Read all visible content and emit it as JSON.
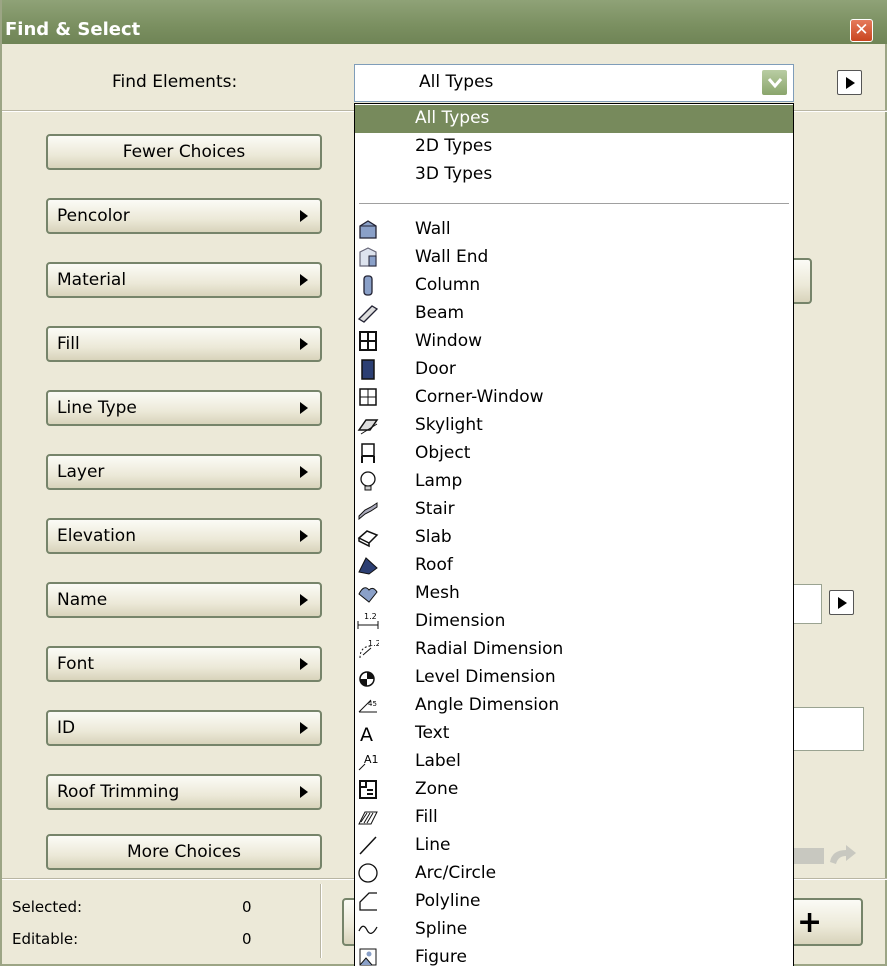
{
  "window": {
    "title": "Find & Select",
    "close_glyph": "✕"
  },
  "find": {
    "label": "Find Elements:",
    "selected": "All Types"
  },
  "buttons": {
    "fewer": "Fewer Choices",
    "more": "More Choices",
    "criteria": [
      "Pencolor",
      "Material",
      "Fill",
      "Line Type",
      "Layer",
      "Elevation",
      "Name",
      "Font",
      "ID",
      "Roof Trimming"
    ]
  },
  "status": {
    "selected_label": "Selected:",
    "selected_value": "0",
    "editable_label": "Editable:",
    "editable_value": "0"
  },
  "plus_glyph": "+",
  "dropdown": {
    "types": [
      "All Types",
      "2D Types",
      "3D Types"
    ],
    "items": [
      {
        "label": "Wall",
        "icon": "wall-icon"
      },
      {
        "label": "Wall End",
        "icon": "wall-end-icon"
      },
      {
        "label": "Column",
        "icon": "column-icon"
      },
      {
        "label": "Beam",
        "icon": "beam-icon"
      },
      {
        "label": "Window",
        "icon": "window-icon"
      },
      {
        "label": "Door",
        "icon": "door-icon"
      },
      {
        "label": "Corner-Window",
        "icon": "corner-window-icon"
      },
      {
        "label": "Skylight",
        "icon": "skylight-icon"
      },
      {
        "label": "Object",
        "icon": "object-icon"
      },
      {
        "label": "Lamp",
        "icon": "lamp-icon"
      },
      {
        "label": "Stair",
        "icon": "stair-icon"
      },
      {
        "label": "Slab",
        "icon": "slab-icon"
      },
      {
        "label": "Roof",
        "icon": "roof-icon"
      },
      {
        "label": "Mesh",
        "icon": "mesh-icon"
      },
      {
        "label": "Dimension",
        "icon": "dimension-icon"
      },
      {
        "label": "Radial Dimension",
        "icon": "radial-dimension-icon"
      },
      {
        "label": "Level Dimension",
        "icon": "level-dimension-icon"
      },
      {
        "label": "Angle Dimension",
        "icon": "angle-dimension-icon"
      },
      {
        "label": "Text",
        "icon": "text-icon"
      },
      {
        "label": "Label",
        "icon": "label-icon"
      },
      {
        "label": "Zone",
        "icon": "zone-icon"
      },
      {
        "label": "Fill",
        "icon": "fill-icon"
      },
      {
        "label": "Line",
        "icon": "line-icon"
      },
      {
        "label": "Arc/Circle",
        "icon": "arc-circle-icon"
      },
      {
        "label": "Polyline",
        "icon": "polyline-icon"
      },
      {
        "label": "Spline",
        "icon": "spline-icon"
      },
      {
        "label": "Figure",
        "icon": "figure-icon"
      }
    ]
  },
  "icon_glyphs": {
    "A1": "A1",
    "A": "A",
    "dim": "1.2"
  },
  "colors": {
    "titlebar": "#7a8f60",
    "selection": "#778a5c",
    "panel": "#ece9d8"
  }
}
